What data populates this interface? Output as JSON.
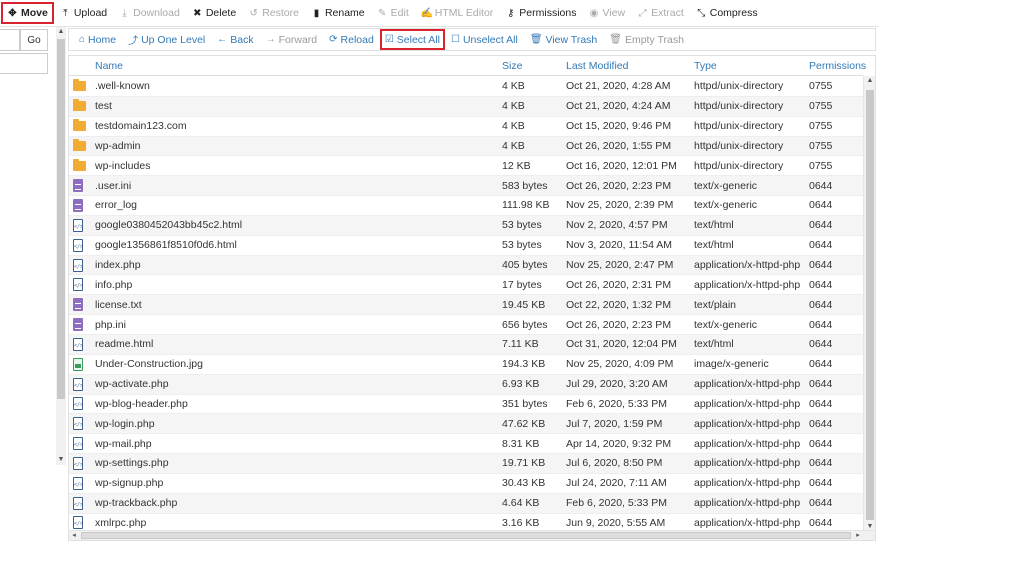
{
  "toolbar": {
    "move": "Move",
    "upload": "Upload",
    "download": "Download",
    "delete": "Delete",
    "restore": "Restore",
    "rename": "Rename",
    "edit": "Edit",
    "html_editor": "HTML Editor",
    "permissions": "Permissions",
    "view": "View",
    "extract": "Extract",
    "compress": "Compress"
  },
  "left": {
    "go": "Go"
  },
  "nav": {
    "home": "Home",
    "up": "Up One Level",
    "back": "Back",
    "forward": "Forward",
    "reload": "Reload",
    "select_all": "Select All",
    "unselect_all": "Unselect All",
    "view_trash": "View Trash",
    "empty_trash": "Empty Trash"
  },
  "table": {
    "headers": {
      "name": "Name",
      "size": "Size",
      "modified": "Last Modified",
      "type": "Type",
      "perms": "Permissions"
    },
    "rows": [
      {
        "icon": "folder-icon",
        "name": ".well-known",
        "size": "4 KB",
        "modified": "Oct 21, 2020, 4:28 AM",
        "type": "httpd/unix-directory",
        "perms": "0755"
      },
      {
        "icon": "folder-icon",
        "name": "test",
        "size": "4 KB",
        "modified": "Oct 21, 2020, 4:24 AM",
        "type": "httpd/unix-directory",
        "perms": "0755"
      },
      {
        "icon": "folder-icon",
        "name": "testdomain123.com",
        "size": "4 KB",
        "modified": "Oct 15, 2020, 9:46 PM",
        "type": "httpd/unix-directory",
        "perms": "0755"
      },
      {
        "icon": "folder-icon",
        "name": "wp-admin",
        "size": "4 KB",
        "modified": "Oct 26, 2020, 1:55 PM",
        "type": "httpd/unix-directory",
        "perms": "0755"
      },
      {
        "icon": "folder-icon",
        "name": "wp-includes",
        "size": "12 KB",
        "modified": "Oct 16, 2020, 12:01 PM",
        "type": "httpd/unix-directory",
        "perms": "0755"
      },
      {
        "icon": "text-file-icon",
        "name": ".user.ini",
        "size": "583 bytes",
        "modified": "Oct 26, 2020, 2:23 PM",
        "type": "text/x-generic",
        "perms": "0644"
      },
      {
        "icon": "text-file-icon",
        "name": "error_log",
        "size": "111.98 KB",
        "modified": "Nov 25, 2020, 2:39 PM",
        "type": "text/x-generic",
        "perms": "0644"
      },
      {
        "icon": "code-file-icon",
        "name": "google0380452043bb45c2.html",
        "size": "53 bytes",
        "modified": "Nov 2, 2020, 4:57 PM",
        "type": "text/html",
        "perms": "0644"
      },
      {
        "icon": "code-file-icon",
        "name": "google1356861f8510f0d6.html",
        "size": "53 bytes",
        "modified": "Nov 3, 2020, 11:54 AM",
        "type": "text/html",
        "perms": "0644"
      },
      {
        "icon": "code-file-icon",
        "name": "index.php",
        "size": "405 bytes",
        "modified": "Nov 25, 2020, 2:47 PM",
        "type": "application/x-httpd-php",
        "perms": "0644"
      },
      {
        "icon": "code-file-icon",
        "name": "info.php",
        "size": "17 bytes",
        "modified": "Oct 26, 2020, 2:31 PM",
        "type": "application/x-httpd-php",
        "perms": "0644"
      },
      {
        "icon": "text-file-icon",
        "name": "license.txt",
        "size": "19.45 KB",
        "modified": "Oct 22, 2020, 1:32 PM",
        "type": "text/plain",
        "perms": "0644"
      },
      {
        "icon": "text-file-icon",
        "name": "php.ini",
        "size": "656 bytes",
        "modified": "Oct 26, 2020, 2:23 PM",
        "type": "text/x-generic",
        "perms": "0644"
      },
      {
        "icon": "code-file-icon",
        "name": "readme.html",
        "size": "7.11 KB",
        "modified": "Oct 31, 2020, 12:04 PM",
        "type": "text/html",
        "perms": "0644"
      },
      {
        "icon": "image-file-icon",
        "name": "Under-Construction.jpg",
        "size": "194.3 KB",
        "modified": "Nov 25, 2020, 4:09 PM",
        "type": "image/x-generic",
        "perms": "0644"
      },
      {
        "icon": "code-file-icon",
        "name": "wp-activate.php",
        "size": "6.93 KB",
        "modified": "Jul 29, 2020, 3:20 AM",
        "type": "application/x-httpd-php",
        "perms": "0644"
      },
      {
        "icon": "code-file-icon",
        "name": "wp-blog-header.php",
        "size": "351 bytes",
        "modified": "Feb 6, 2020, 5:33 PM",
        "type": "application/x-httpd-php",
        "perms": "0644"
      },
      {
        "icon": "code-file-icon",
        "name": "wp-login.php",
        "size": "47.62 KB",
        "modified": "Jul 7, 2020, 1:59 PM",
        "type": "application/x-httpd-php",
        "perms": "0644"
      },
      {
        "icon": "code-file-icon",
        "name": "wp-mail.php",
        "size": "8.31 KB",
        "modified": "Apr 14, 2020, 9:32 PM",
        "type": "application/x-httpd-php",
        "perms": "0644"
      },
      {
        "icon": "code-file-icon",
        "name": "wp-settings.php",
        "size": "19.71 KB",
        "modified": "Jul 6, 2020, 8:50 PM",
        "type": "application/x-httpd-php",
        "perms": "0644"
      },
      {
        "icon": "code-file-icon",
        "name": "wp-signup.php",
        "size": "30.43 KB",
        "modified": "Jul 24, 2020, 7:11 AM",
        "type": "application/x-httpd-php",
        "perms": "0644"
      },
      {
        "icon": "code-file-icon",
        "name": "wp-trackback.php",
        "size": "4.64 KB",
        "modified": "Feb 6, 2020, 5:33 PM",
        "type": "application/x-httpd-php",
        "perms": "0644"
      },
      {
        "icon": "code-file-icon",
        "name": "xmlrpc.php",
        "size": "3.16 KB",
        "modified": "Jun 9, 2020, 5:55 AM",
        "type": "application/x-httpd-php",
        "perms": "0644"
      }
    ]
  },
  "colors": {
    "link": "#337ab7",
    "highlight_border": "#d9232e",
    "folder": "#f0ad32"
  }
}
